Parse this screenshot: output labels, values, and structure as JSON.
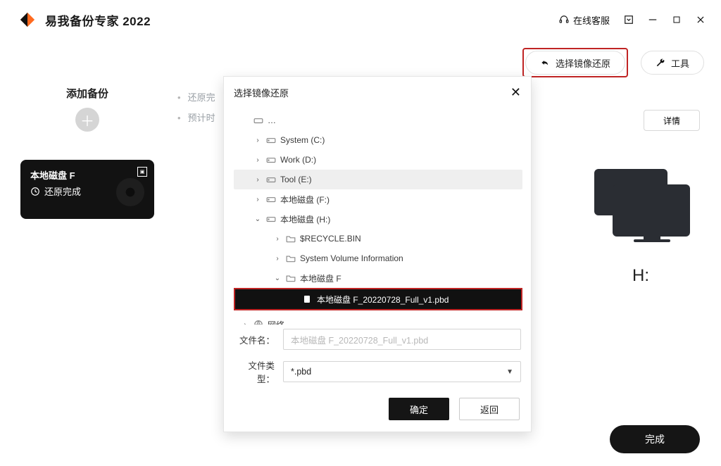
{
  "app": {
    "title": "易我备份专家 2022",
    "online_support": "在线客服"
  },
  "toolbar": {
    "select_image_restore": "选择镜像还原",
    "tools": "工具"
  },
  "details_btn": "详情",
  "mid": {
    "restore": "还原完",
    "plan": "预计时"
  },
  "left": {
    "add_backup": "添加备份",
    "card_title": "本地磁盘 F",
    "card_status": "还原完成"
  },
  "right": {
    "drive_letter": "H:"
  },
  "finish_btn": "完成",
  "dialog": {
    "title": "选择镜像还原",
    "truncated_row": "…",
    "tree": {
      "system_c": "System (C:)",
      "work_d": "Work (D:)",
      "tool_e": "Tool (E:)",
      "local_f": "本地磁盘 (F:)",
      "local_h": "本地磁盘 (H:)",
      "recycle": "$RECYCLE.BIN",
      "sysvol": "System Volume Information",
      "local_f_folder": "本地磁盘 F",
      "file": "本地磁盘 F_20220728_Full_v1.pbd",
      "network": "网络"
    },
    "filename_label": "文件名：",
    "filename_placeholder": "本地磁盘 F_20220728_Full_v1.pbd",
    "filetype_label": "文件类型：",
    "filetype_value": "*.pbd",
    "ok": "确定",
    "back": "返回"
  }
}
